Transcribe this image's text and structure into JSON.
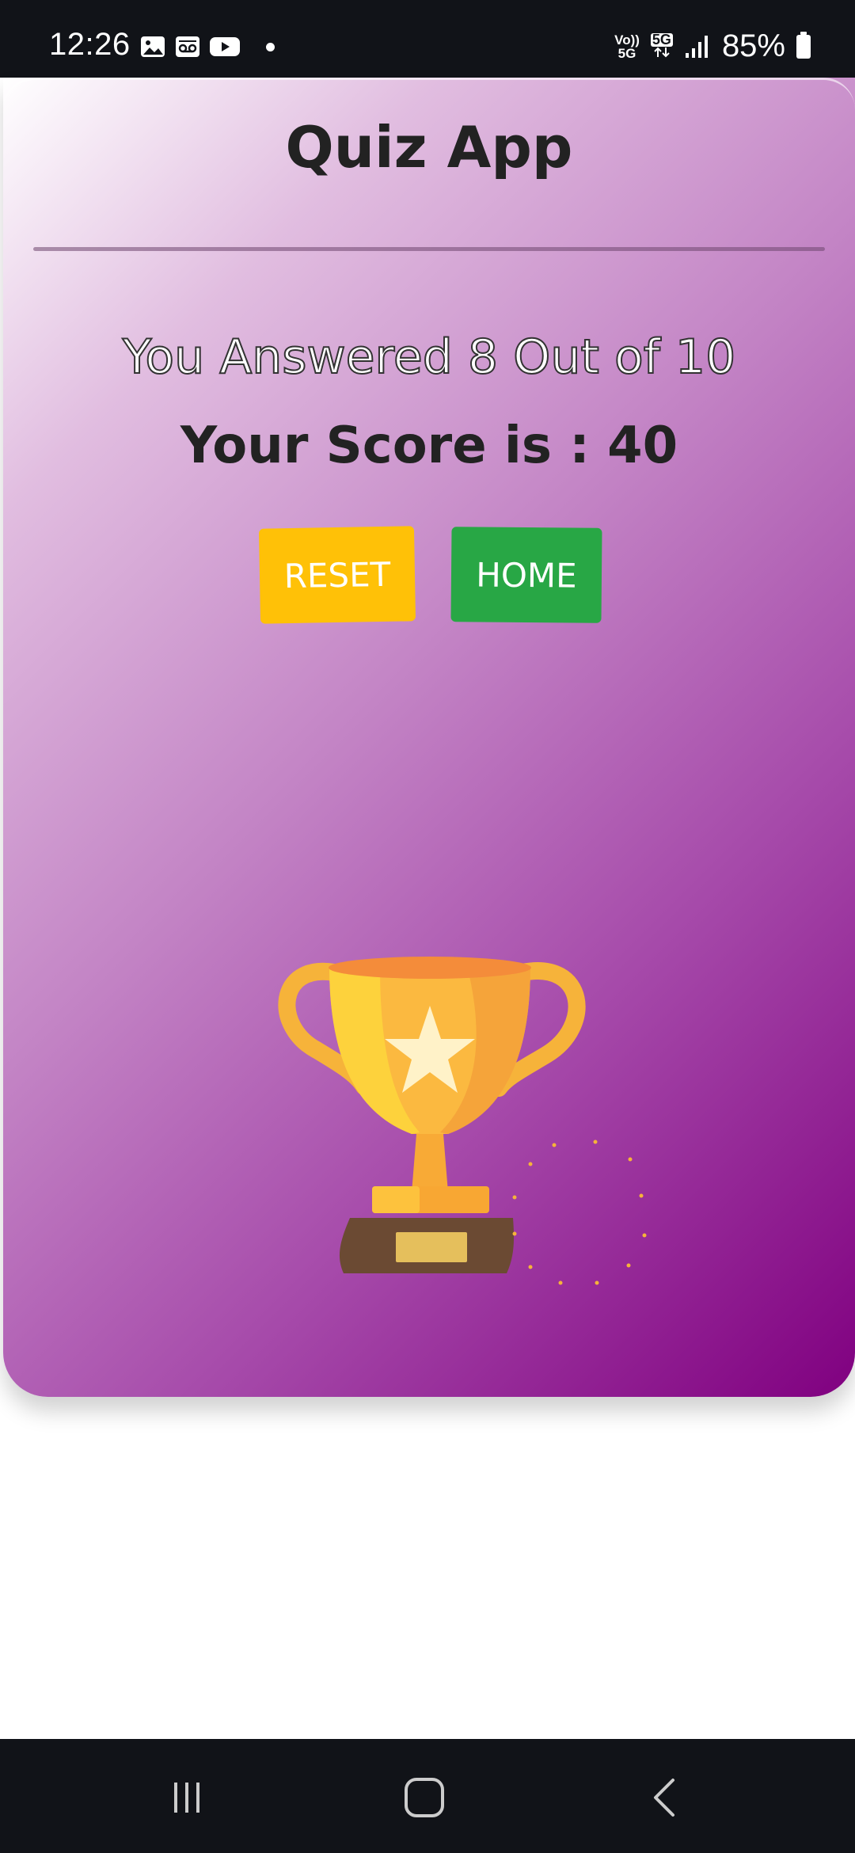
{
  "status_bar": {
    "time": "12:26",
    "icons_left": [
      "gallery-icon",
      "voicemail-icon",
      "youtube-icon",
      "notification-dot-icon"
    ],
    "network_top": "Vo))",
    "network_bottom": "5G",
    "network_5g": "5G",
    "battery": "85%"
  },
  "app": {
    "title": "Quiz App",
    "answered_text": "You Answered 8 Out of 10",
    "score_text": "Your Score is : 40",
    "buttons": {
      "reset": "RESET",
      "home": "HOME"
    },
    "image": "trophy-icon"
  },
  "colors": {
    "reset": "#ffc107",
    "home": "#28a745",
    "gradient_end": "#800080"
  },
  "nav_bar": {
    "icons": [
      "recent-apps-icon",
      "home-icon",
      "back-icon"
    ]
  }
}
